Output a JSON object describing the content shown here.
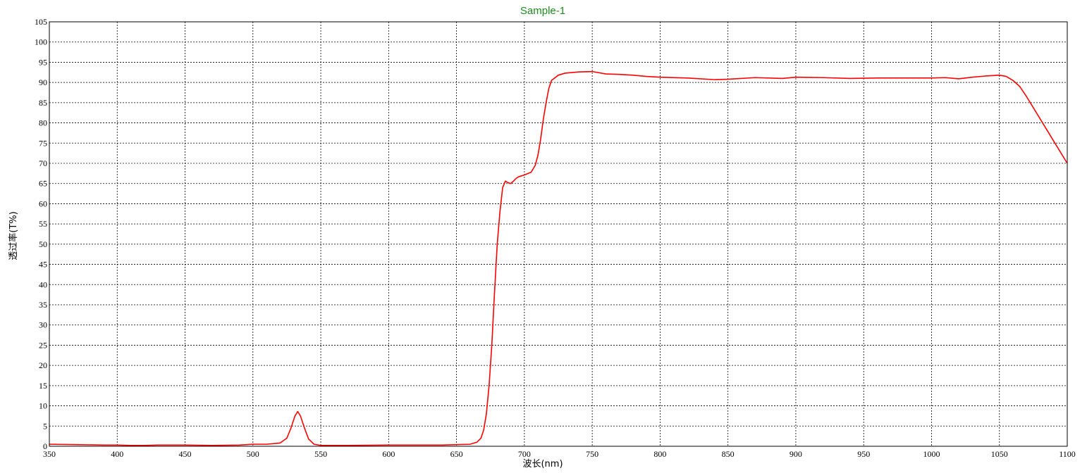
{
  "chart_data": {
    "type": "line",
    "title": "Sample-1",
    "xlabel": "波长(nm)",
    "ylabel": "透过率(T%)",
    "xlim": [
      350,
      1100
    ],
    "ylim": [
      0,
      105
    ],
    "x_ticks": [
      "350",
      "400",
      "450",
      "500",
      "550",
      "600",
      "650",
      "700",
      "750",
      "800",
      "850",
      "900",
      "950",
      "1000",
      "1050",
      "1100"
    ],
    "y_ticks": [
      "0",
      "5",
      "10",
      "15",
      "20",
      "25",
      "30",
      "35",
      "40",
      "45",
      "50",
      "55",
      "60",
      "65",
      "70",
      "75",
      "80",
      "85",
      "90",
      "95",
      "100",
      "105"
    ],
    "grid": true,
    "colors": {
      "title": "#1f8a1f",
      "series": "#ff0000"
    },
    "series": [
      {
        "color": "#ff0000",
        "x": [
          350,
          370,
          390,
          400,
          410,
          420,
          430,
          450,
          470,
          490,
          500,
          510,
          520,
          525,
          528,
          531,
          533,
          535,
          538,
          541,
          545,
          550,
          570,
          600,
          640,
          660,
          665,
          668,
          670,
          672,
          674,
          676,
          678,
          680,
          682,
          684,
          686,
          688,
          690,
          692,
          694,
          696,
          698,
          700,
          705,
          708,
          710,
          712,
          714,
          716,
          718,
          720,
          725,
          730,
          740,
          750,
          760,
          770,
          780,
          790,
          800,
          820,
          840,
          850,
          870,
          890,
          900,
          920,
          940,
          960,
          980,
          1000,
          1010,
          1020,
          1030,
          1040,
          1050,
          1055,
          1060,
          1065,
          1070,
          1080,
          1090,
          1100
        ],
        "y": [
          0.5,
          0.4,
          0.3,
          0.3,
          0.2,
          0.2,
          0.3,
          0.3,
          0.2,
          0.3,
          0.5,
          0.5,
          0.8,
          2.0,
          4.5,
          7.5,
          8.6,
          7.5,
          4.5,
          1.8,
          0.5,
          0.2,
          0.2,
          0.3,
          0.3,
          0.5,
          1.0,
          2.0,
          4.0,
          8.0,
          15.0,
          25.0,
          38.0,
          50.0,
          58.0,
          64.0,
          65.6,
          65.2,
          65.0,
          65.6,
          66.3,
          66.7,
          66.9,
          67.1,
          67.8,
          69.5,
          72.0,
          76.0,
          81.0,
          85.0,
          88.5,
          90.5,
          91.8,
          92.3,
          92.6,
          92.7,
          92.1,
          92.0,
          91.8,
          91.5,
          91.3,
          91.1,
          90.7,
          90.8,
          91.2,
          91.0,
          91.3,
          91.2,
          91.0,
          91.1,
          91.1,
          91.1,
          91.2,
          90.9,
          91.3,
          91.6,
          91.8,
          91.5,
          90.5,
          89.0,
          86.5,
          81.0,
          75.5,
          70.0
        ]
      }
    ]
  }
}
